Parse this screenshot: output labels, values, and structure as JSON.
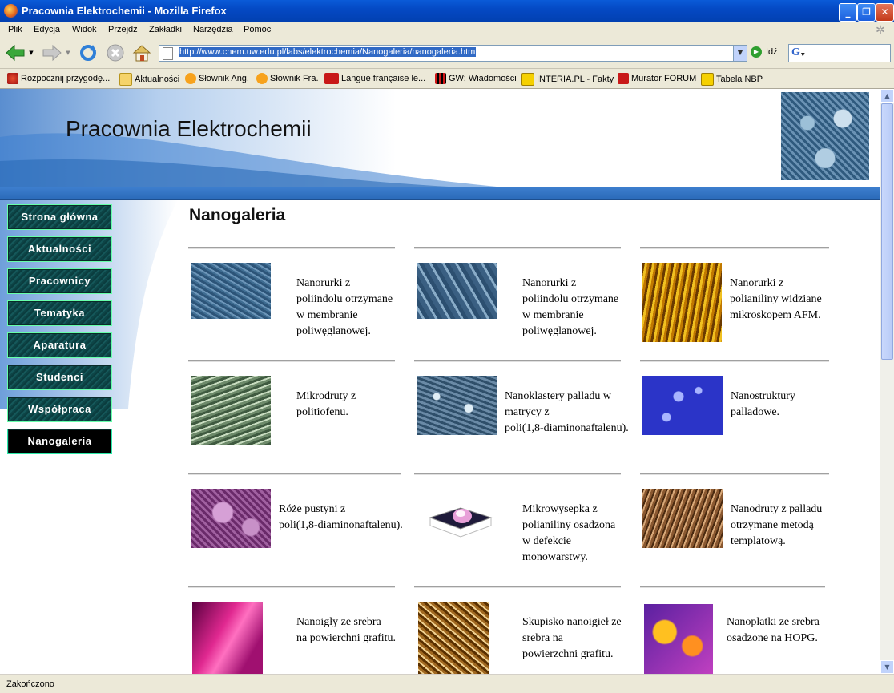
{
  "window": {
    "title": "Pracownia Elektrochemii - Mozilla Firefox"
  },
  "menu": [
    "Plik",
    "Edycja",
    "Widok",
    "Przejdź",
    "Zakładki",
    "Narzędzia",
    "Pomoc"
  ],
  "toolbar": {
    "url": "http://www.chem.uw.edu.pl/labs/elektrochemia/Nanogaleria/nanogaleria.htm",
    "go_label": "Idź",
    "search_placeholder": ""
  },
  "bookmarks": [
    {
      "label": "Rozpocznij przygodę...",
      "icon": "firefox-red-icon"
    },
    {
      "label": "Aktualności",
      "icon": "folder-icon"
    },
    {
      "label": "Słownik Ang.",
      "icon": "onet-icon"
    },
    {
      "label": "Słownik Fra.",
      "icon": "onet-icon"
    },
    {
      "label": "Langue française  le...",
      "icon": "dna-icon"
    },
    {
      "label": "GW: Wiadomości",
      "icon": "gw-icon"
    },
    {
      "label": "INTERIA.PL - Fakty",
      "icon": "interia-icon"
    },
    {
      "label": "Murator FORUM",
      "icon": "murator-icon"
    },
    {
      "label": "Tabela NBP",
      "icon": "interia-icon"
    }
  ],
  "site": {
    "title": "Pracownia Elektrochemii",
    "page_title": "Nanogaleria",
    "nav": [
      "Strona główna",
      "Aktualności",
      "Pracownicy",
      "Tematyka",
      "Aparatura",
      "Studenci",
      "Współpraca",
      "Nanogaleria"
    ],
    "active_nav": "Nanogaleria"
  },
  "gallery": [
    {
      "caption": [
        "Nanorurki z",
        "poliindolu otrzymane",
        "w membranie",
        "poliwęglanowej."
      ]
    },
    {
      "caption": [
        "Nanorurki z",
        "poliindolu otrzymane",
        "w membranie",
        "poliwęglanowej."
      ]
    },
    {
      "caption": [
        "Nanorurki z",
        "polianiliny widziane",
        "mikroskopem AFM."
      ]
    },
    {
      "caption": [
        "Mikrodruty z",
        "politiofenu."
      ]
    },
    {
      "caption": [
        "Nanoklastery palladu w",
        "matrycy z",
        "poli(1,8-diaminonaftalenu)."
      ]
    },
    {
      "caption": [
        "Nanostruktury",
        "palladowe."
      ]
    },
    {
      "caption": [
        "Róże pustyni z",
        "poli(1,8-diaminonaftalenu)."
      ]
    },
    {
      "caption": [
        "Mikrowysepka z",
        "polianiliny osadzona",
        "w defekcie",
        "monowarstwy."
      ]
    },
    {
      "caption": [
        "Nanodruty z palladu",
        "otrzymane metodą",
        "templatową."
      ]
    },
    {
      "caption": [
        "Nanoigły ze srebra",
        "na powierchni grafitu."
      ]
    },
    {
      "caption": [
        "Skupisko nanoigieł ze",
        "srebra na",
        "powierzchni grafitu."
      ]
    },
    {
      "caption": [
        "Nanopłatki ze srebra",
        "osadzone na HOPG."
      ]
    }
  ],
  "status": "Zakończono"
}
